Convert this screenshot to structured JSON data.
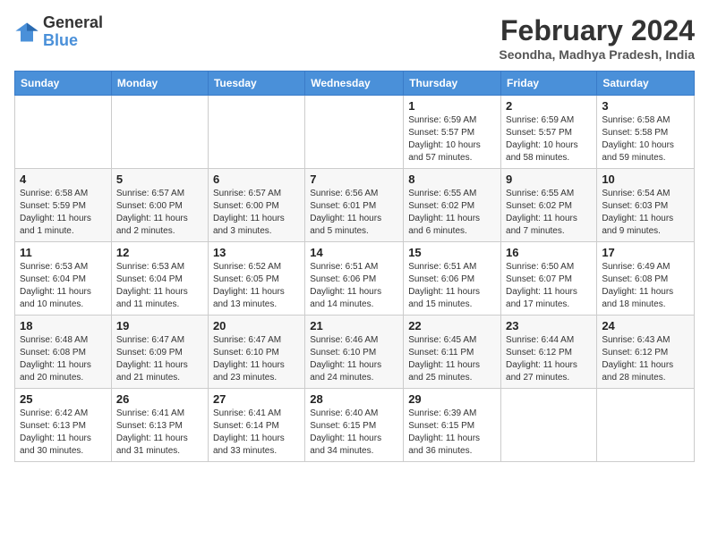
{
  "logo": {
    "line1": "General",
    "line2": "Blue"
  },
  "header": {
    "month_year": "February 2024",
    "location": "Seondha, Madhya Pradesh, India"
  },
  "weekdays": [
    "Sunday",
    "Monday",
    "Tuesday",
    "Wednesday",
    "Thursday",
    "Friday",
    "Saturday"
  ],
  "weeks": [
    [
      {
        "day": "",
        "info": ""
      },
      {
        "day": "",
        "info": ""
      },
      {
        "day": "",
        "info": ""
      },
      {
        "day": "",
        "info": ""
      },
      {
        "day": "1",
        "info": "Sunrise: 6:59 AM\nSunset: 5:57 PM\nDaylight: 10 hours and 57 minutes."
      },
      {
        "day": "2",
        "info": "Sunrise: 6:59 AM\nSunset: 5:57 PM\nDaylight: 10 hours and 58 minutes."
      },
      {
        "day": "3",
        "info": "Sunrise: 6:58 AM\nSunset: 5:58 PM\nDaylight: 10 hours and 59 minutes."
      }
    ],
    [
      {
        "day": "4",
        "info": "Sunrise: 6:58 AM\nSunset: 5:59 PM\nDaylight: 11 hours and 1 minute."
      },
      {
        "day": "5",
        "info": "Sunrise: 6:57 AM\nSunset: 6:00 PM\nDaylight: 11 hours and 2 minutes."
      },
      {
        "day": "6",
        "info": "Sunrise: 6:57 AM\nSunset: 6:00 PM\nDaylight: 11 hours and 3 minutes."
      },
      {
        "day": "7",
        "info": "Sunrise: 6:56 AM\nSunset: 6:01 PM\nDaylight: 11 hours and 5 minutes."
      },
      {
        "day": "8",
        "info": "Sunrise: 6:55 AM\nSunset: 6:02 PM\nDaylight: 11 hours and 6 minutes."
      },
      {
        "day": "9",
        "info": "Sunrise: 6:55 AM\nSunset: 6:02 PM\nDaylight: 11 hours and 7 minutes."
      },
      {
        "day": "10",
        "info": "Sunrise: 6:54 AM\nSunset: 6:03 PM\nDaylight: 11 hours and 9 minutes."
      }
    ],
    [
      {
        "day": "11",
        "info": "Sunrise: 6:53 AM\nSunset: 6:04 PM\nDaylight: 11 hours and 10 minutes."
      },
      {
        "day": "12",
        "info": "Sunrise: 6:53 AM\nSunset: 6:04 PM\nDaylight: 11 hours and 11 minutes."
      },
      {
        "day": "13",
        "info": "Sunrise: 6:52 AM\nSunset: 6:05 PM\nDaylight: 11 hours and 13 minutes."
      },
      {
        "day": "14",
        "info": "Sunrise: 6:51 AM\nSunset: 6:06 PM\nDaylight: 11 hours and 14 minutes."
      },
      {
        "day": "15",
        "info": "Sunrise: 6:51 AM\nSunset: 6:06 PM\nDaylight: 11 hours and 15 minutes."
      },
      {
        "day": "16",
        "info": "Sunrise: 6:50 AM\nSunset: 6:07 PM\nDaylight: 11 hours and 17 minutes."
      },
      {
        "day": "17",
        "info": "Sunrise: 6:49 AM\nSunset: 6:08 PM\nDaylight: 11 hours and 18 minutes."
      }
    ],
    [
      {
        "day": "18",
        "info": "Sunrise: 6:48 AM\nSunset: 6:08 PM\nDaylight: 11 hours and 20 minutes."
      },
      {
        "day": "19",
        "info": "Sunrise: 6:47 AM\nSunset: 6:09 PM\nDaylight: 11 hours and 21 minutes."
      },
      {
        "day": "20",
        "info": "Sunrise: 6:47 AM\nSunset: 6:10 PM\nDaylight: 11 hours and 23 minutes."
      },
      {
        "day": "21",
        "info": "Sunrise: 6:46 AM\nSunset: 6:10 PM\nDaylight: 11 hours and 24 minutes."
      },
      {
        "day": "22",
        "info": "Sunrise: 6:45 AM\nSunset: 6:11 PM\nDaylight: 11 hours and 25 minutes."
      },
      {
        "day": "23",
        "info": "Sunrise: 6:44 AM\nSunset: 6:12 PM\nDaylight: 11 hours and 27 minutes."
      },
      {
        "day": "24",
        "info": "Sunrise: 6:43 AM\nSunset: 6:12 PM\nDaylight: 11 hours and 28 minutes."
      }
    ],
    [
      {
        "day": "25",
        "info": "Sunrise: 6:42 AM\nSunset: 6:13 PM\nDaylight: 11 hours and 30 minutes."
      },
      {
        "day": "26",
        "info": "Sunrise: 6:41 AM\nSunset: 6:13 PM\nDaylight: 11 hours and 31 minutes."
      },
      {
        "day": "27",
        "info": "Sunrise: 6:41 AM\nSunset: 6:14 PM\nDaylight: 11 hours and 33 minutes."
      },
      {
        "day": "28",
        "info": "Sunrise: 6:40 AM\nSunset: 6:15 PM\nDaylight: 11 hours and 34 minutes."
      },
      {
        "day": "29",
        "info": "Sunrise: 6:39 AM\nSunset: 6:15 PM\nDaylight: 11 hours and 36 minutes."
      },
      {
        "day": "",
        "info": ""
      },
      {
        "day": "",
        "info": ""
      }
    ]
  ]
}
